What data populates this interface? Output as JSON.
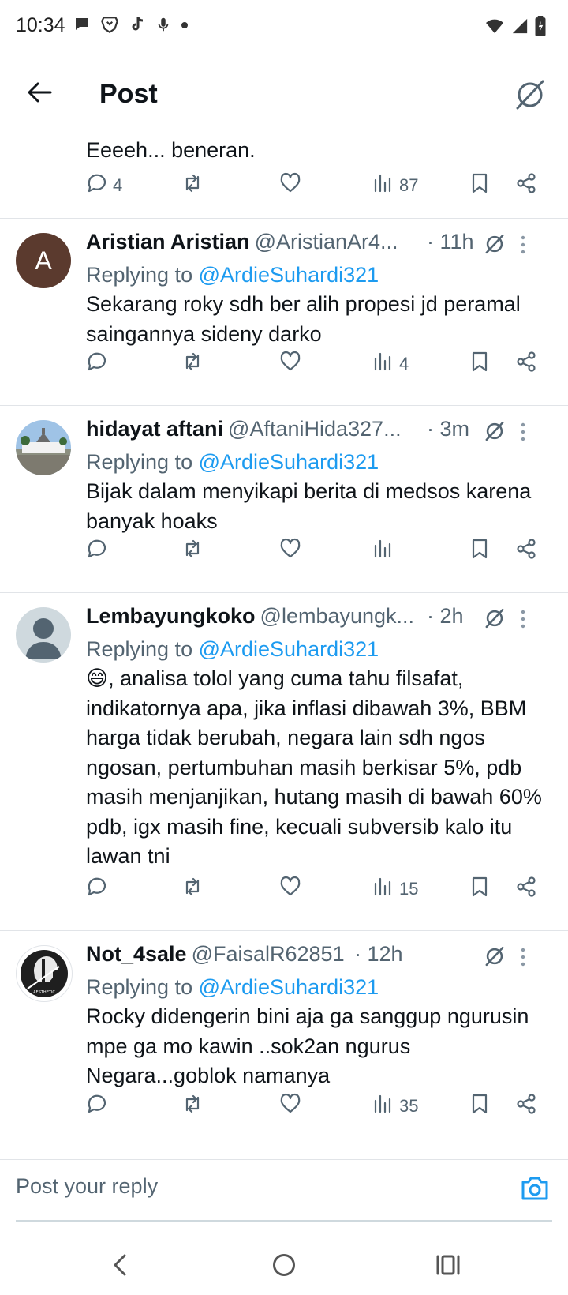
{
  "status_bar": {
    "time": "10:34",
    "left_icons": [
      "chat-bubble-icon",
      "brave-browser-icon",
      "tiktok-icon",
      "microphone-icon",
      "dot-icon"
    ],
    "right_icons": [
      "wifi-icon",
      "signal-icon",
      "battery-icon"
    ]
  },
  "header": {
    "title": "Post",
    "back_icon": "arrow-left-icon",
    "right_icon": "grok-icon"
  },
  "top_post": {
    "text": "Eeeeh... beneran.",
    "replies": "4",
    "views": "87"
  },
  "tweets": [
    {
      "name": "Aristian Aristian",
      "handle": "@AristianAr4...",
      "time": "· 11h",
      "replying_label": "Replying to ",
      "replying_to": "@ArdieSuhardi321",
      "text": "Sekarang roky sdh ber alih propesi jd peramal saingannya sideny darko",
      "views": "4",
      "avatar_letter": "A",
      "avatar_color": "#5b3a2e"
    },
    {
      "name": "hidayat aftani",
      "handle": "@AftaniHida327...",
      "time": "· 3m",
      "replying_label": "Replying to ",
      "replying_to": "@ArdieSuhardi321",
      "text": "Bijak dalam menyikapi berita di medsos karena banyak hoaks",
      "views": ""
    },
    {
      "name": "Lembayungkoko",
      "handle": "@lembayungk...",
      "time": "· 2h",
      "replying_label": "Replying to ",
      "replying_to": "@ArdieSuhardi321",
      "text": "😄, analisa tolol yang cuma tahu filsafat, indikatornya apa, jika inflasi dibawah 3%, BBM harga tidak berubah, negara lain sdh ngos ngosan, pertumbuhan masih berkisar 5%, pdb masih menjanjikan, hutang masih di bawah 60% pdb, igx masih fine, kecuali subversib kalo itu lawan tni",
      "views": "15"
    },
    {
      "name": "Not_4sale",
      "handle": "@FaisalR62851",
      "time": "· 12h",
      "replying_label": "Replying to ",
      "replying_to": "@ArdieSuhardi321",
      "text": "Rocky didengerin bini aja ga sanggup ngurusin mpe ga mo kawin ..sok2an ngurus Negara...goblok namanya",
      "views": "35",
      "avatar_badge": "AESTHETIC"
    }
  ],
  "reply_bar": {
    "placeholder": "Post your reply"
  },
  "colors": {
    "accent": "#1d9bf0",
    "secondary_text": "#536471",
    "primary_text": "#0f1419",
    "divider": "#e1e4e8"
  }
}
